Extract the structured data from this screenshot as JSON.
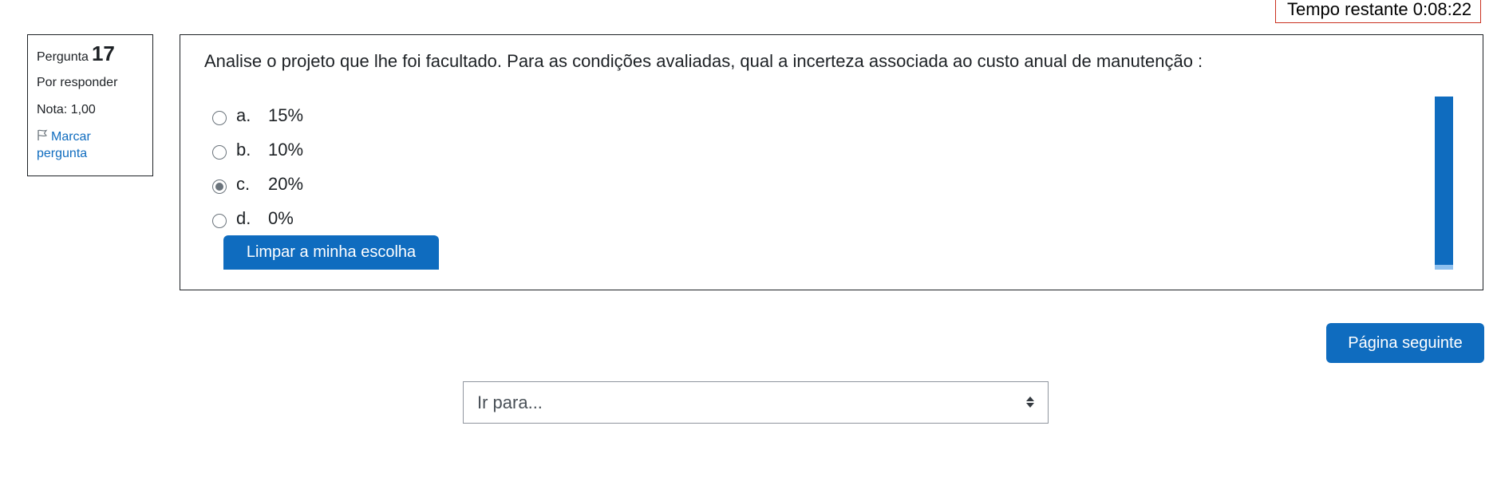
{
  "timer": {
    "label": "Tempo restante 0:08:22"
  },
  "question_info": {
    "label": "Pergunta",
    "number": "17",
    "state": "Por responder",
    "grade": "Nota: 1,00",
    "flag_label": "Marcar pergunta",
    "flag_icon": "flag-outline-icon"
  },
  "question": {
    "text": "Analise o projeto que lhe foi facultado. Para as condições avaliadas, qual a incerteza associada ao custo anual de manutenção :",
    "answers": [
      {
        "letter": "a.",
        "text": "15%",
        "selected": false
      },
      {
        "letter": "b.",
        "text": "10%",
        "selected": false
      },
      {
        "letter": "c.",
        "text": "20%",
        "selected": true
      },
      {
        "letter": "d.",
        "text": "0%",
        "selected": false
      }
    ],
    "clear_label": "Limpar a minha escolha"
  },
  "navigation": {
    "next_label": "Página seguinte",
    "jump_placeholder": "Ir para...",
    "jump_icon": "sort-arrows-icon"
  },
  "colors": {
    "primary": "#0f6cbf",
    "timer_border": "#ca3120",
    "text": "#1d2125"
  }
}
